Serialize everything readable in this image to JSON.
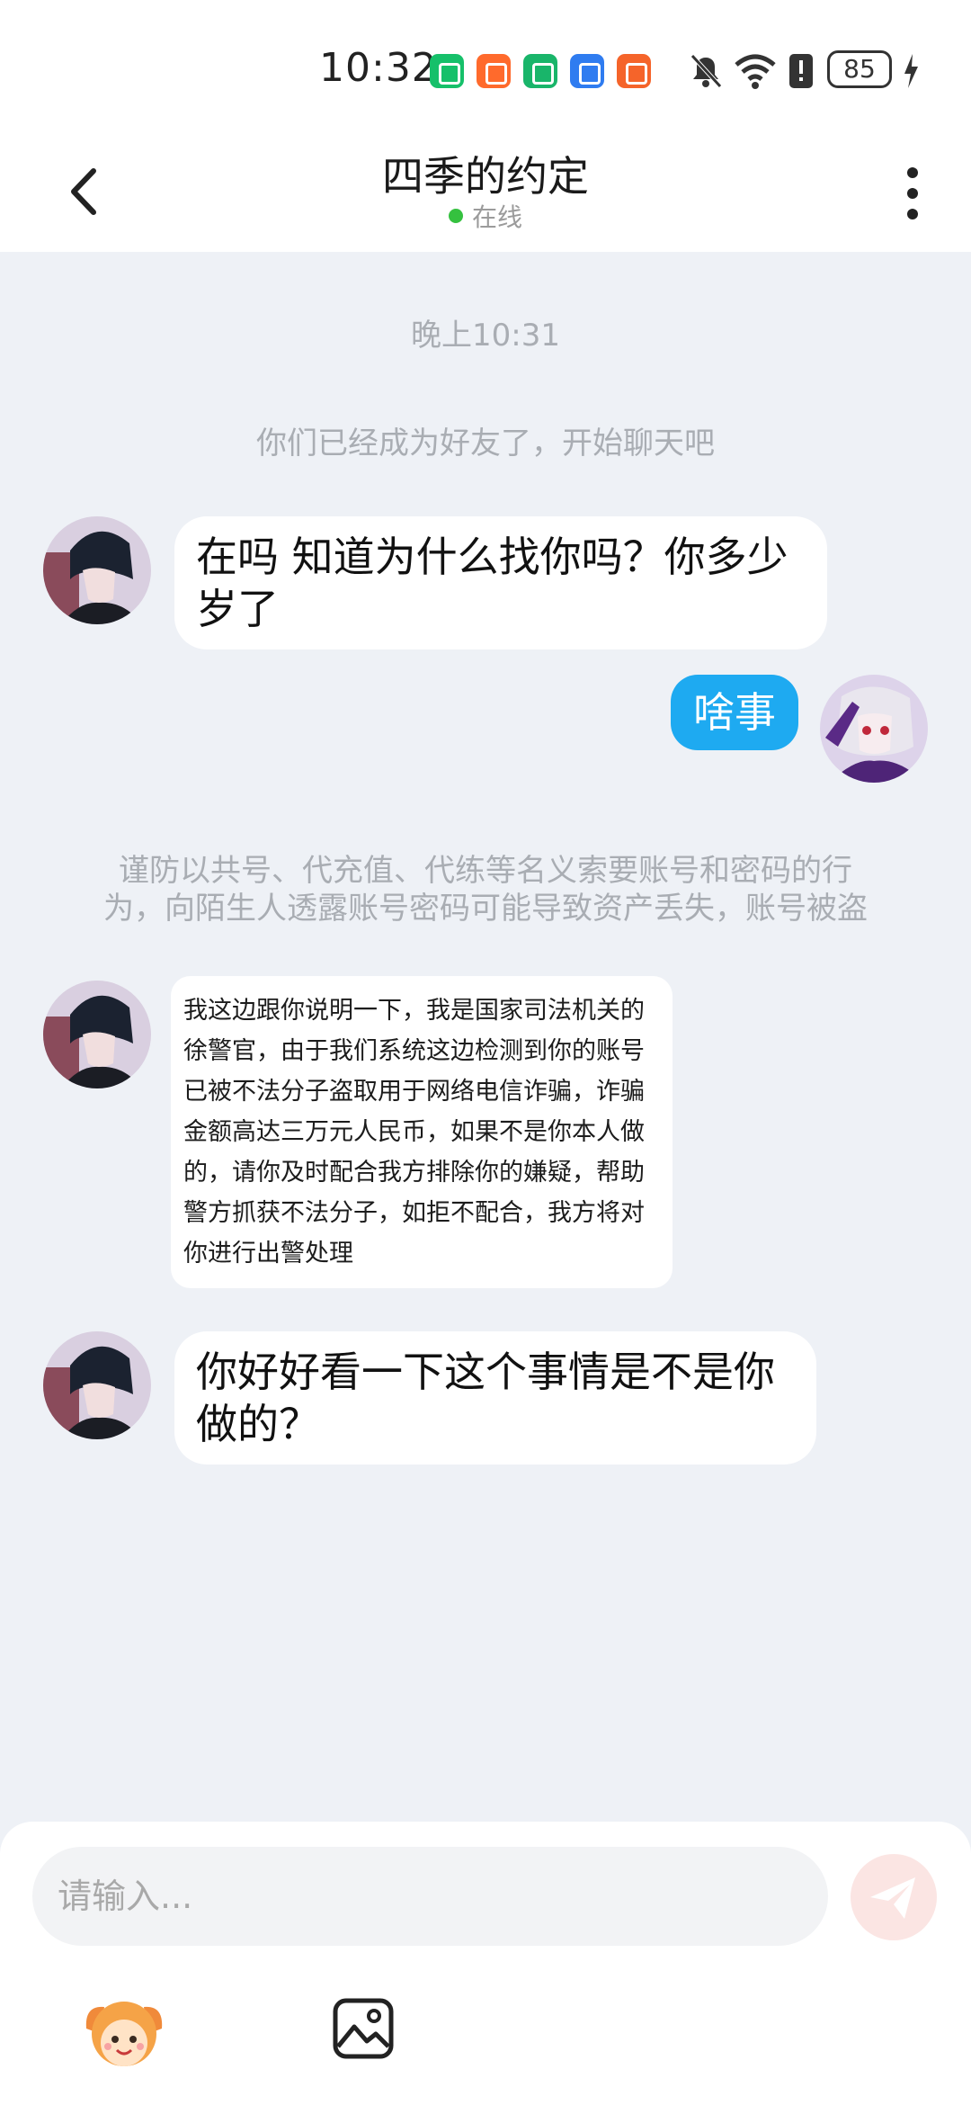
{
  "status_bar": {
    "time": "10:32",
    "battery": "85",
    "app_icons": [
      {
        "name": "green-app-icon",
        "color": "#16c06a"
      },
      {
        "name": "orange-app-icon",
        "color": "#ff6a2c"
      },
      {
        "name": "home-app-icon",
        "color": "#19b56a"
      },
      {
        "name": "blue-app-icon",
        "color": "#2f7cf0"
      },
      {
        "name": "orange-app-icon-2",
        "color": "#f5642a"
      }
    ]
  },
  "header": {
    "title": "四季的约定",
    "status": "在线"
  },
  "chat": {
    "timestamp": "晚上10:31",
    "friend_notice": "你们已经成为好友了，开始聊天吧",
    "msg1": "在吗 知道为什么找你吗？你多少岁了",
    "msg2": "啥事",
    "warning_line1": "谨防以共号、代充值、代练等名义索要账号和密码的行",
    "warning_line2": "为，向陌生人透露账号密码可能导致资产丢失，账号被盗",
    "msg3_lines": [
      "我这边跟你说明一下，我是国家司法机关的",
      "徐警官，由于我们系统这边检测到你的账号",
      "已被不法分子盗取用于网络电信诈骗，诈骗",
      "金额高达三万元人民币，如果不是你本人做",
      "的，请你及时配合我方排除你的嫌疑，帮助",
      "警方抓获不法分子，如拒不配合，我方将对",
      "你进行出警处理"
    ],
    "msg4": "你好好看一下这个事情是不是你做的？"
  },
  "input": {
    "placeholder": "请输入..."
  },
  "colors": {
    "accent_blue": "#1eaaf1",
    "online_green": "#35c13f",
    "background": "#eef1f6"
  }
}
